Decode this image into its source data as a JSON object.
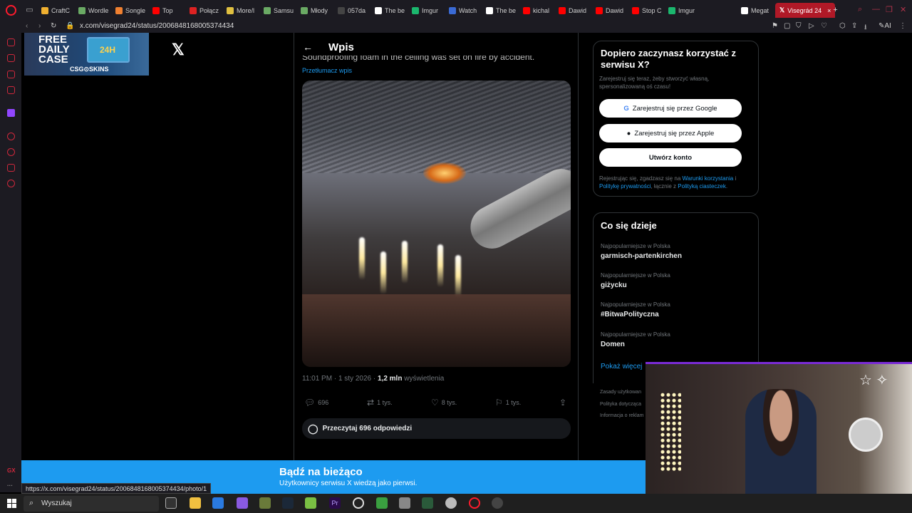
{
  "browser": {
    "tabs": [
      {
        "label": "CraftC",
        "color": "#f0b030"
      },
      {
        "label": "Wordle",
        "color": "#6aaa64"
      },
      {
        "label": "Songle",
        "color": "#f08030"
      },
      {
        "label": "Top",
        "color": "#ff0000"
      },
      {
        "label": "Połącz",
        "color": "#dd2222"
      },
      {
        "label": "More/l",
        "color": "#e0c040"
      },
      {
        "label": "Samsu",
        "color": "#6aaa64"
      },
      {
        "label": "Młody",
        "color": "#6aaa64"
      },
      {
        "label": "057da",
        "color": "#444"
      },
      {
        "label": "The be",
        "color": "#fff"
      },
      {
        "label": "Imgur",
        "color": "#1bb76e"
      },
      {
        "label": "Watch",
        "color": "#3a6ad4"
      },
      {
        "label": "The be",
        "color": "#fff"
      },
      {
        "label": "kichal",
        "color": "#ff0000"
      },
      {
        "label": "Dawid",
        "color": "#ff0000"
      },
      {
        "label": "Dawid",
        "color": "#ff0000"
      },
      {
        "label": "Stop C",
        "color": "#ff0000"
      },
      {
        "label": "Imgur",
        "color": "#1bb76e"
      },
      {
        "label": "Megat",
        "color": "#fff"
      }
    ],
    "active_tab": "Visegrád 24",
    "url": "x.com/visegrad24/status/2006848168005374434",
    "status_url": "https://x.com/visegrad24/status/2006848168005374434/photo/1"
  },
  "ad": {
    "line1": "FREE",
    "line2": "DAILY",
    "line3": "CASE",
    "badge": "24H",
    "brand": "CSG⊙SKINS"
  },
  "post": {
    "header": "Wpis",
    "text": "Soundproofing foam in the ceiling was set on fire by accident.",
    "translate": "Przetłumacz wpis",
    "time": "11:01 PM · 1 sty 2026 · ",
    "views_num": "1,2 mln",
    "views_label": " wyświetlenia",
    "replies": "696",
    "reposts": "1 tys.",
    "likes": "8 tys.",
    "bookmarks": "1 tys.",
    "read_replies": "Przeczytaj 696 odpowiedzi"
  },
  "signup": {
    "title": "Dopiero zaczynasz korzystać z serwisu X?",
    "subtitle": "Zarejestruj się teraz, żeby stworzyć własną, spersonalizowaną oś czasu!",
    "google": "Zarejestruj się przez Google",
    "apple": "Zarejestruj się przez Apple",
    "create": "Utwórz konto",
    "legal_a": "Rejestrując się, zgadzasz się na ",
    "legal_terms": "Warunki korzystania",
    "legal_b": " i ",
    "legal_privacy": "Politykę prywatności",
    "legal_c": ", łącznie z ",
    "legal_cookies": "Polityką ciasteczek",
    "legal_d": "."
  },
  "trends": {
    "title": "Co się dzieje",
    "items": [
      {
        "category": "Najpopularniejsze w Polska",
        "name": "garmisch-partenkirchen"
      },
      {
        "category": "Najpopularniejsze w Polska",
        "name": "giżycku"
      },
      {
        "category": "Najpopularniejsze w Polska",
        "name": "#BitwaPolityczna"
      },
      {
        "category": "Najpopularniejsze w Polska",
        "name": "Domen"
      }
    ],
    "show_more": "Pokaż więcej"
  },
  "footer": [
    "Zasady użytkowan",
    "Polityka dotycząca",
    "Informacja o reklam"
  ],
  "banner": {
    "title": "Bądź na bieżąco",
    "subtitle": "Użytkownicy serwisu X wiedzą jako pierwsi."
  },
  "taskbar": {
    "search": "Wyszukaj"
  }
}
